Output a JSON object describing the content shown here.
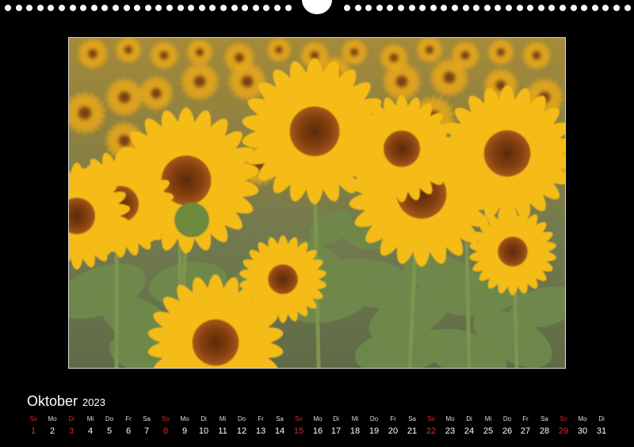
{
  "calendar": {
    "month": "Oktober",
    "year": "2023",
    "days": [
      {
        "wd": "So",
        "n": "1",
        "sun": true
      },
      {
        "wd": "Mo",
        "n": "2"
      },
      {
        "wd": "Di",
        "n": "3",
        "sun": true
      },
      {
        "wd": "Mi",
        "n": "4"
      },
      {
        "wd": "Do",
        "n": "5"
      },
      {
        "wd": "Fr",
        "n": "6"
      },
      {
        "wd": "Sa",
        "n": "7"
      },
      {
        "wd": "So",
        "n": "8",
        "sun": true
      },
      {
        "wd": "Mo",
        "n": "9"
      },
      {
        "wd": "Di",
        "n": "10"
      },
      {
        "wd": "Mi",
        "n": "11"
      },
      {
        "wd": "Do",
        "n": "12"
      },
      {
        "wd": "Fr",
        "n": "13"
      },
      {
        "wd": "Sa",
        "n": "14"
      },
      {
        "wd": "So",
        "n": "15",
        "sun": true
      },
      {
        "wd": "Mo",
        "n": "16"
      },
      {
        "wd": "Di",
        "n": "17"
      },
      {
        "wd": "Mi",
        "n": "18"
      },
      {
        "wd": "Do",
        "n": "19"
      },
      {
        "wd": "Fr",
        "n": "20"
      },
      {
        "wd": "Sa",
        "n": "21"
      },
      {
        "wd": "So",
        "n": "22",
        "sun": true
      },
      {
        "wd": "Mo",
        "n": "23"
      },
      {
        "wd": "Di",
        "n": "24"
      },
      {
        "wd": "Mi",
        "n": "25"
      },
      {
        "wd": "Do",
        "n": "26"
      },
      {
        "wd": "Fr",
        "n": "27"
      },
      {
        "wd": "Sa",
        "n": "28"
      },
      {
        "wd": "So",
        "n": "29",
        "sun": true
      },
      {
        "wd": "Mo",
        "n": "30"
      },
      {
        "wd": "Di",
        "n": "31"
      }
    ]
  },
  "colors": {
    "background": "#000000",
    "sunday": "#d03030",
    "petal": "#f2b51c",
    "center": "#7a3a10"
  }
}
